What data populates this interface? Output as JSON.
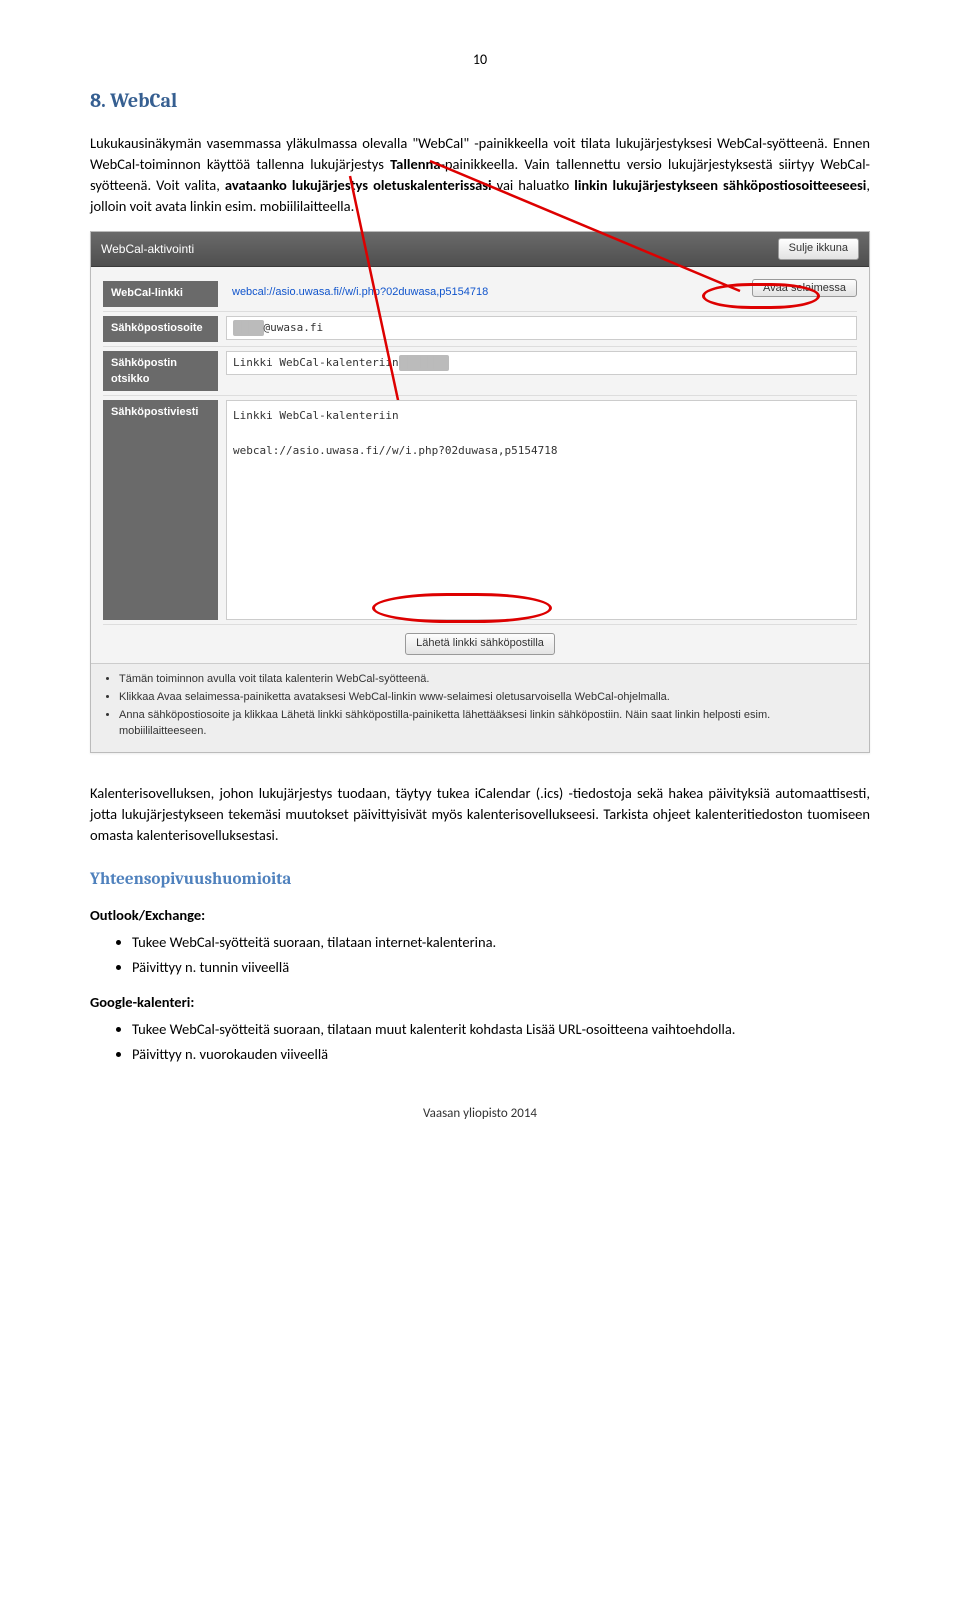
{
  "page_number": "10",
  "heading": "8. WebCal",
  "para1_a": "Lukukausinäkymän vasemmassa yläkulmassa olevalla \"WebCal\" -painikkeella voit tilata lukujärjestyksesi WebCal-syötteenä. Ennen WebCal-toiminnon käyttöä tallenna lukujärjestys ",
  "para1_b": "Tallenna",
  "para1_c": "-painikkeella. Vain tallennettu versio lukujärjestyksestä siirtyy WebCal-syötteenä. Voit valita, ",
  "para1_d": "avataanko lukujärjestys oletuskalenterissasi",
  "para1_e": " vai haluatko ",
  "para1_f": "linkin lukujärjestykseen sähköpostiosoitteeseesi",
  "para1_g": ", jolloin voit avata linkin esim. mobiililaitteella.",
  "scr": {
    "title": "WebCal-aktivointi",
    "close_btn": "Sulje ikkuna",
    "rows": {
      "r1_label": "WebCal-linkki",
      "r1_value": "webcal://asio.uwasa.fi//w/i.php?02duwasa,p5154718",
      "r1_btn": "Avaa selaimessa",
      "r2_label": "Sähköpostiosoite",
      "r2_value": "@uwasa.fi",
      "r3_label": "Sähköpostin otsikko",
      "r3_value": "Linkki WebCal-kalenteriin",
      "r4_label": "Sähköpostiviesti",
      "r4_value": "Linkki WebCal-kalenteriin \n\nwebcal://asio.uwasa.fi//w/i.php?02duwasa,p5154718"
    },
    "send_btn": "Lähetä linkki sähköpostilla",
    "help": [
      "Tämän toiminnon avulla voit tilata kalenterin WebCal-syötteenä.",
      "Klikkaa Avaa selaimessa-painiketta avataksesi WebCal-linkin www-selaimesi oletusarvoisella WebCal-ohjelmalla.",
      "Anna sähköpostiosoite ja klikkaa Lähetä linkki sähköpostilla-painiketta lähettääksesi linkin sähköpostiin. Näin saat linkin helposti esim. mobiililaitteeseen."
    ]
  },
  "para2": "Kalenterisovelluksen, johon lukujärjestys tuodaan, täytyy tukea iCalendar (.ics) -tiedostoja sekä hakea päivityksiä automaattisesti, jotta lukujärjestykseen tekemäsi muutokset päivittyisivät myös kalenterisovellukseesi. Tarkista ohjeet kalenteritiedoston tuomiseen omasta kalenterisovelluksestasi.",
  "subhead": "Yhteensopivuushuomioita",
  "outlook_label": "Outlook/Exchange:",
  "outlook_items": [
    "Tukee WebCal-syötteitä suoraan, tilataan internet-kalenterina.",
    "Päivittyy n. tunnin viiveellä"
  ],
  "google_label": "Google-kalenteri:",
  "google_items": [
    "Tukee WebCal-syötteitä suoraan, tilataan muut kalenterit kohdasta Lisää URL-osoitteena vaihtoehdolla.",
    "Päivittyy n. vuorokauden viiveellä"
  ],
  "footer": "Vaasan yliopisto 2014"
}
